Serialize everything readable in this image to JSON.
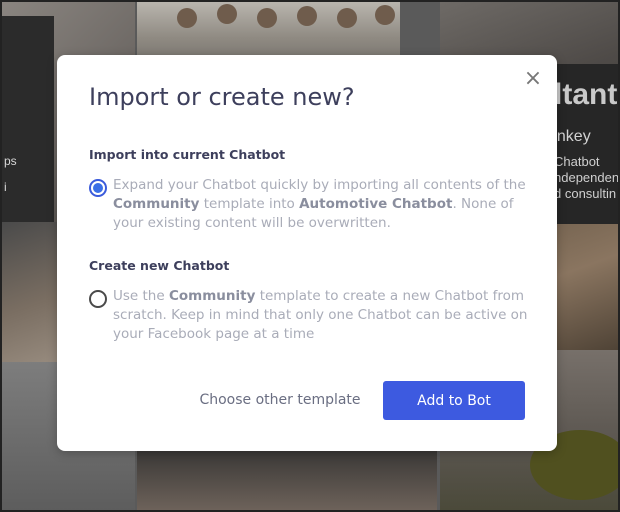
{
  "background": {
    "left_tile": {
      "lines": [
        "ps",
        "i"
      ]
    },
    "right_tile": {
      "title": "ltant",
      "subtitle": "onkey",
      "lines": [
        "Chatbot",
        "ndependent",
        "d consultin"
      ]
    }
  },
  "modal": {
    "title": "Import or create new?",
    "close_icon": "×",
    "import_section": {
      "label": "Import into current Chatbot",
      "text_1": "Expand your Chatbot quickly by importing all contents of the",
      "template_name": "Community",
      "text_2": "template into",
      "bot_name": "Automotive Chatbot",
      "text_3": ". None of your existing content will be overwritten.",
      "selected": true
    },
    "create_section": {
      "label": "Create new Chatbot",
      "text_1": "Use the",
      "template_name": "Community",
      "text_2": "template to create a new Chatbot from scratch. Keep in mind that only one Chatbot can be active on your Facebook page at a time",
      "selected": false
    },
    "buttons": {
      "secondary": "Choose other template",
      "primary": "Add to Bot"
    }
  },
  "colors": {
    "accent": "#3d5ae0",
    "title": "#3d3f5c",
    "muted_text": "#a9acb8"
  }
}
